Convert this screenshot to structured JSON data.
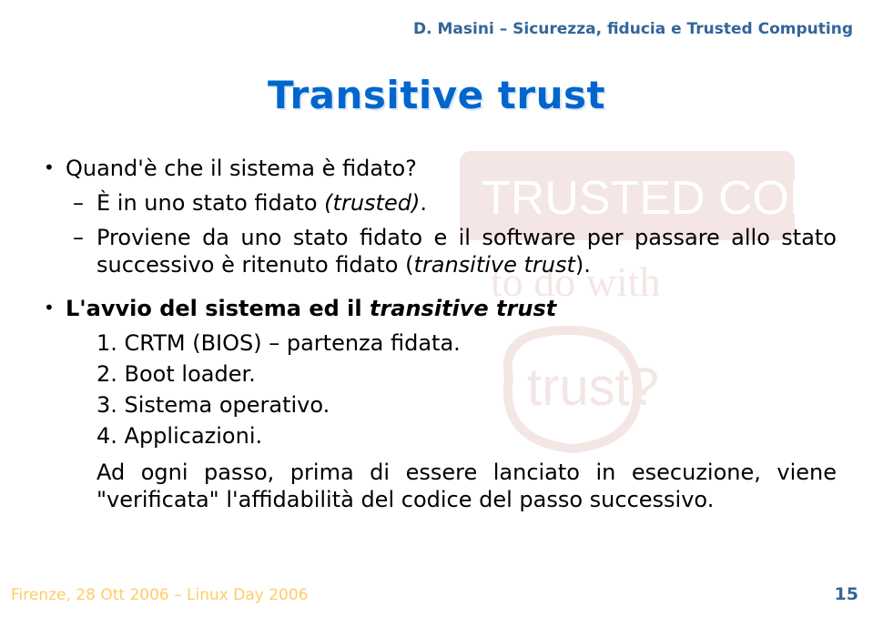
{
  "header": {
    "author": "D. Masini",
    "separator": " – ",
    "topic": "Sicurezza, fiducia e Trusted Computing"
  },
  "title": "Transitive trust",
  "b1_q": "Quand'è che il sistema è fidato?",
  "b1_s1_a": "È in uno stato fidato ",
  "b1_s1_b": "(trusted)",
  "b1_s1_c": ".",
  "b1_s2_a": "Proviene da uno stato fidato e il software per passare allo stato successivo è ritenuto fidato (",
  "b1_s2_b": "transitive trust",
  "b1_s2_c": ").",
  "b2_a": "L'avvio del sistema ed il ",
  "b2_b": "transitive trust",
  "n1": "1. CRTM (BIOS) – partenza fidata.",
  "n2": "2. Boot loader.",
  "n3": "3. Sistema operativo.",
  "n4": "4. Applicazioni.",
  "p1": "Ad ogni passo, prima di essere lanciato in esecuzione, viene \"verificata\" l'affidabilità del codice del passo successivo.",
  "footer": {
    "text": "Firenze, 28 Ott 2006 – Linux Day 2006",
    "page": "15"
  }
}
